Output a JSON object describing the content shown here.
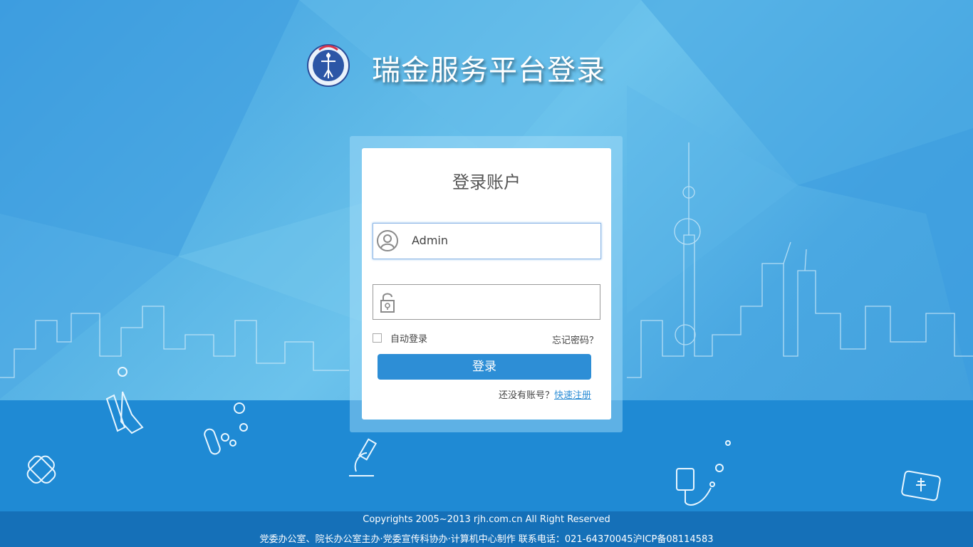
{
  "header": {
    "title": "瑞金服务平台登录",
    "logo_icon": "ruijin-hospital-logo"
  },
  "login": {
    "title": "登录账户",
    "username_value": "Admin",
    "username_icon": "user-icon",
    "password_value": "",
    "password_icon": "lock-icon",
    "remember_label": "自动登录",
    "remember_checked": false,
    "forgot_label": "忘记密码？",
    "submit_label": "登录",
    "signup_prompt": "还没有账号？",
    "signup_link": "快速注册"
  },
  "footer": {
    "copyright": "Copyrights 2005~2013 rjh.com.cn All Right Reserved",
    "credits": "党委办公室、院长办公室主办·党委宣传科协办·计算机中心制作 联系电话：021-64370045沪ICP备08114583"
  },
  "colors": {
    "accent": "#2d8ed6",
    "footer": "#1570b8",
    "water": "#1f8ad4"
  }
}
